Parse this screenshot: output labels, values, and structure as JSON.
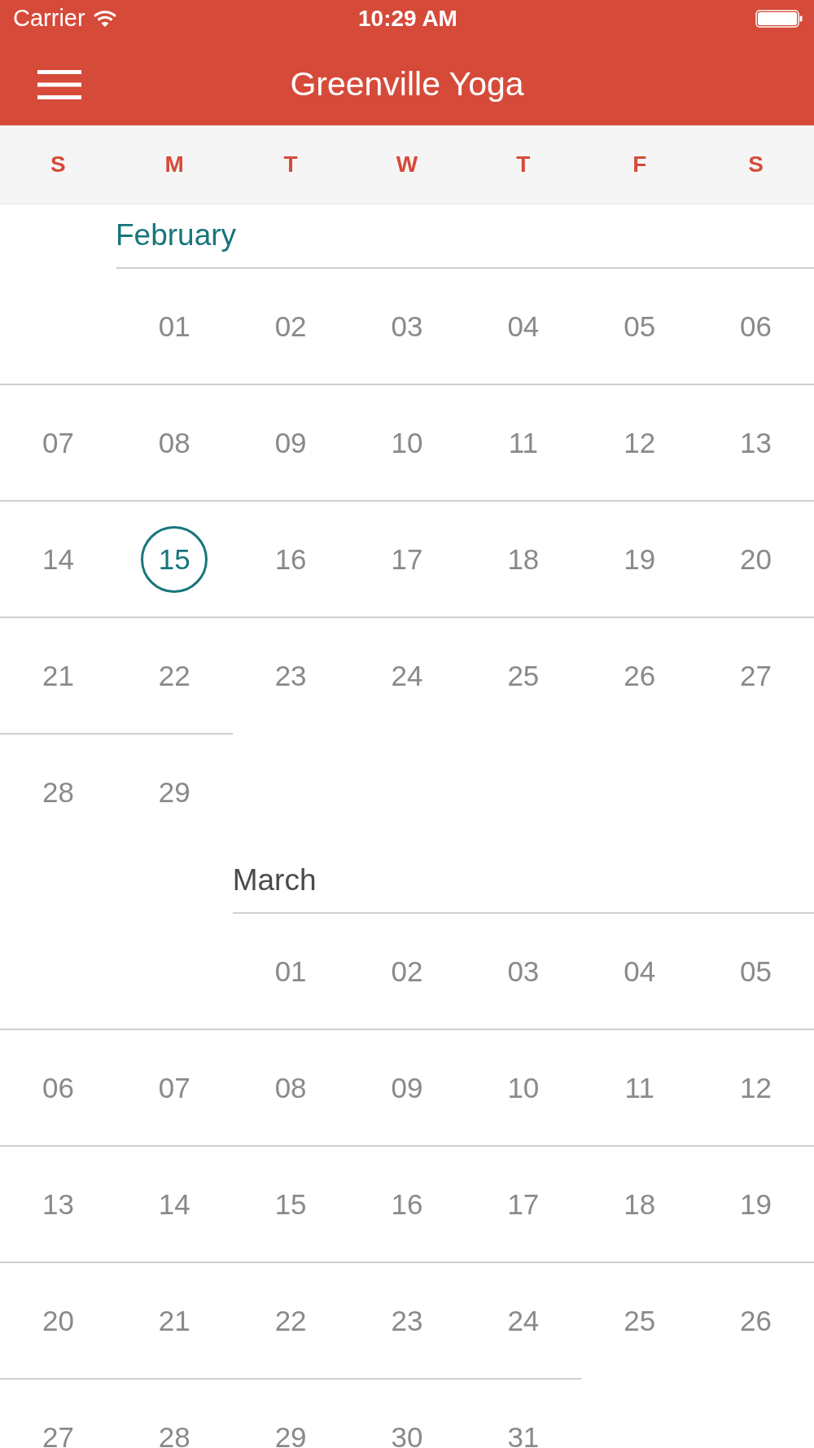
{
  "status_bar": {
    "carrier": "Carrier",
    "time": "10:29 AM"
  },
  "nav_bar": {
    "title": "Greenville Yoga"
  },
  "weekdays": [
    "S",
    "M",
    "T",
    "W",
    "T",
    "F",
    "S"
  ],
  "months": [
    {
      "name": "February",
      "current": true,
      "weeks": [
        {
          "kind": "first",
          "days": [
            {
              "label": "01",
              "selected": false
            },
            {
              "label": "02",
              "selected": false
            },
            {
              "label": "03",
              "selected": false
            },
            {
              "label": "04",
              "selected": false
            },
            {
              "label": "05",
              "selected": false
            },
            {
              "label": "06",
              "selected": false
            }
          ]
        },
        {
          "kind": "week",
          "days": [
            {
              "label": "07",
              "selected": false
            },
            {
              "label": "08",
              "selected": false
            },
            {
              "label": "09",
              "selected": false
            },
            {
              "label": "10",
              "selected": false
            },
            {
              "label": "11",
              "selected": false
            },
            {
              "label": "12",
              "selected": false
            },
            {
              "label": "13",
              "selected": false
            }
          ]
        },
        {
          "kind": "week",
          "days": [
            {
              "label": "14",
              "selected": false
            },
            {
              "label": "15",
              "selected": true
            },
            {
              "label": "16",
              "selected": false
            },
            {
              "label": "17",
              "selected": false
            },
            {
              "label": "18",
              "selected": false
            },
            {
              "label": "19",
              "selected": false
            },
            {
              "label": "20",
              "selected": false
            }
          ]
        },
        {
          "kind": "week",
          "days": [
            {
              "label": "21",
              "selected": false
            },
            {
              "label": "22",
              "selected": false
            },
            {
              "label": "23",
              "selected": false
            },
            {
              "label": "24",
              "selected": false
            },
            {
              "label": "25",
              "selected": false
            },
            {
              "label": "26",
              "selected": false
            },
            {
              "label": "27",
              "selected": false
            }
          ]
        },
        {
          "kind": "week",
          "days": [
            {
              "label": "28",
              "selected": false
            },
            {
              "label": "29",
              "selected": false
            }
          ]
        }
      ]
    },
    {
      "name": "March",
      "current": false,
      "weeks": [
        {
          "kind": "first",
          "days": [
            {
              "label": "01",
              "selected": false
            },
            {
              "label": "02",
              "selected": false
            },
            {
              "label": "03",
              "selected": false
            },
            {
              "label": "04",
              "selected": false
            },
            {
              "label": "05",
              "selected": false
            }
          ]
        },
        {
          "kind": "week",
          "days": [
            {
              "label": "06",
              "selected": false
            },
            {
              "label": "07",
              "selected": false
            },
            {
              "label": "08",
              "selected": false
            },
            {
              "label": "09",
              "selected": false
            },
            {
              "label": "10",
              "selected": false
            },
            {
              "label": "11",
              "selected": false
            },
            {
              "label": "12",
              "selected": false
            }
          ]
        },
        {
          "kind": "week",
          "days": [
            {
              "label": "13",
              "selected": false
            },
            {
              "label": "14",
              "selected": false
            },
            {
              "label": "15",
              "selected": false
            },
            {
              "label": "16",
              "selected": false
            },
            {
              "label": "17",
              "selected": false
            },
            {
              "label": "18",
              "selected": false
            },
            {
              "label": "19",
              "selected": false
            }
          ]
        },
        {
          "kind": "week",
          "days": [
            {
              "label": "20",
              "selected": false
            },
            {
              "label": "21",
              "selected": false
            },
            {
              "label": "22",
              "selected": false
            },
            {
              "label": "23",
              "selected": false
            },
            {
              "label": "24",
              "selected": false
            },
            {
              "label": "25",
              "selected": false
            },
            {
              "label": "26",
              "selected": false
            }
          ]
        },
        {
          "kind": "week",
          "days": [
            {
              "label": "27",
              "selected": false
            },
            {
              "label": "28",
              "selected": false
            },
            {
              "label": "29",
              "selected": false
            },
            {
              "label": "30",
              "selected": false
            },
            {
              "label": "31",
              "selected": false
            }
          ]
        }
      ]
    }
  ]
}
